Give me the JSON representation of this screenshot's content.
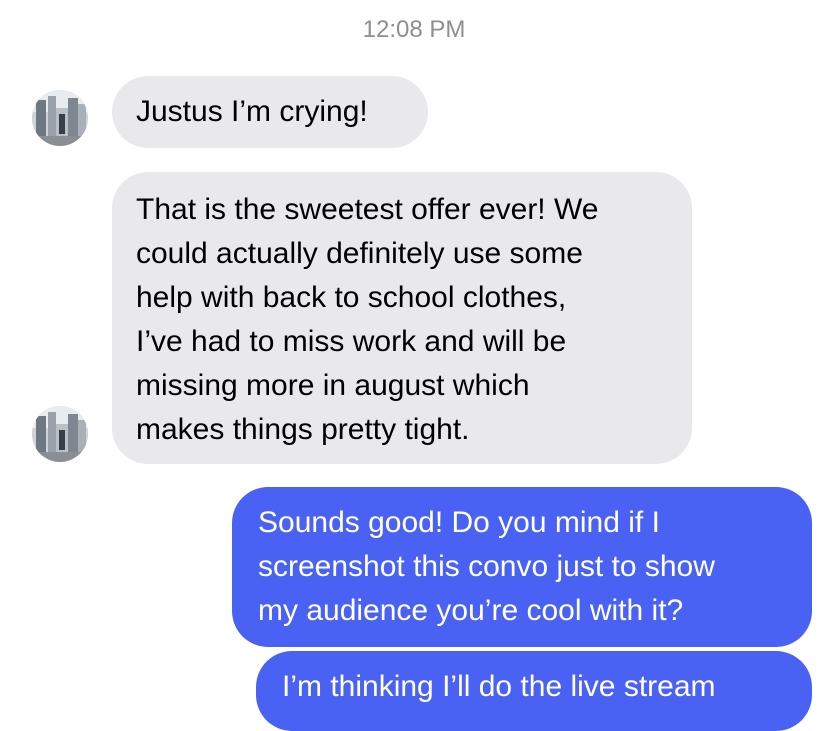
{
  "conversation": {
    "timestamp": "12:08 PM",
    "colors": {
      "incoming_bubble": "#e9e9eb",
      "outgoing_bubble": "#4a62f3",
      "timestamp": "#8e8e93"
    },
    "messages": [
      {
        "sender": "contact",
        "text": "Justus I’m crying!"
      },
      {
        "sender": "contact",
        "text": "That is the sweetest offer ever! We\ncould actually definitely use some\nhelp with back to school clothes,\nI’ve had to miss work and will be\nmissing more in august which\nmakes things pretty tight."
      },
      {
        "sender": "me",
        "text": "Sounds good! Do you mind if I\nscreenshot this convo just to show\nmy audience you’re cool with it?"
      },
      {
        "sender": "me",
        "text": "I’m thinking I’ll do the live stream"
      }
    ],
    "avatars": [
      {
        "icon": "contact-avatar-icon"
      },
      {
        "icon": "contact-avatar-icon"
      }
    ]
  }
}
